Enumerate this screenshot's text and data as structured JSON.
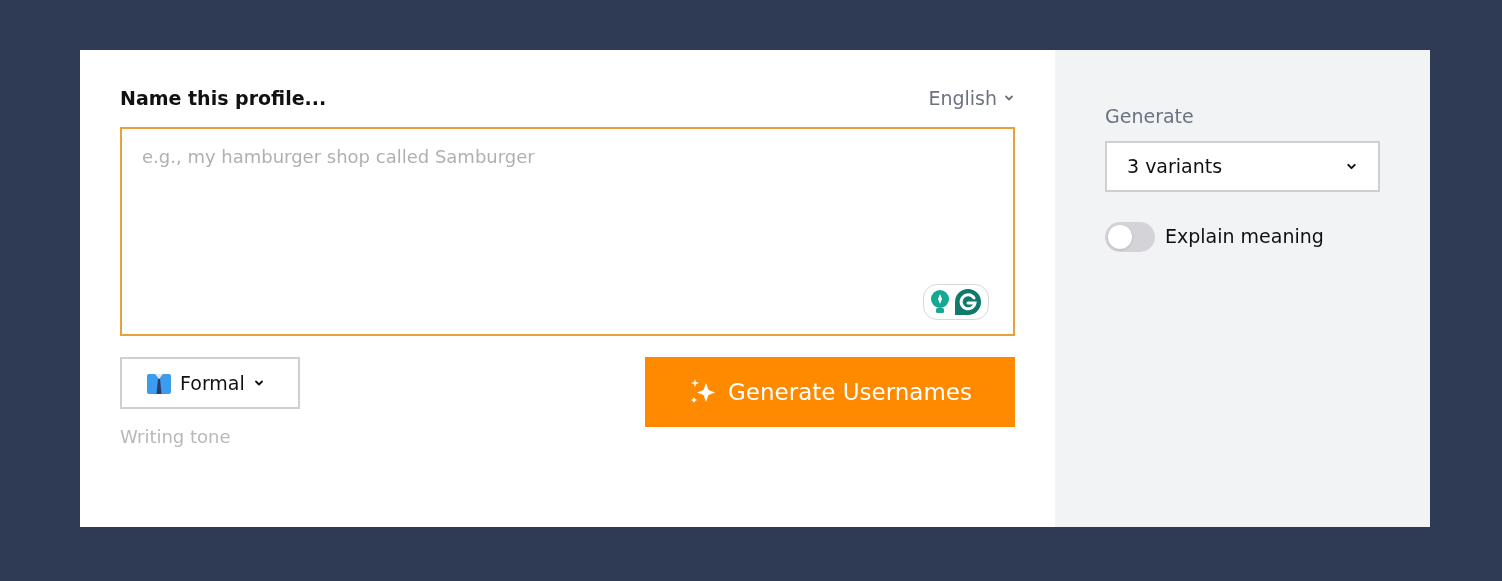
{
  "form": {
    "title": "Name this profile...",
    "language": "English",
    "textarea": {
      "placeholder": "e.g., my hamburger shop called Samburger"
    },
    "tone": {
      "value": "Formal",
      "label": "Writing tone"
    },
    "submit": "Generate Usernames"
  },
  "options": {
    "generate_label": "Generate",
    "variants": "3 variants",
    "explain": {
      "label": "Explain meaning",
      "on": false
    }
  }
}
